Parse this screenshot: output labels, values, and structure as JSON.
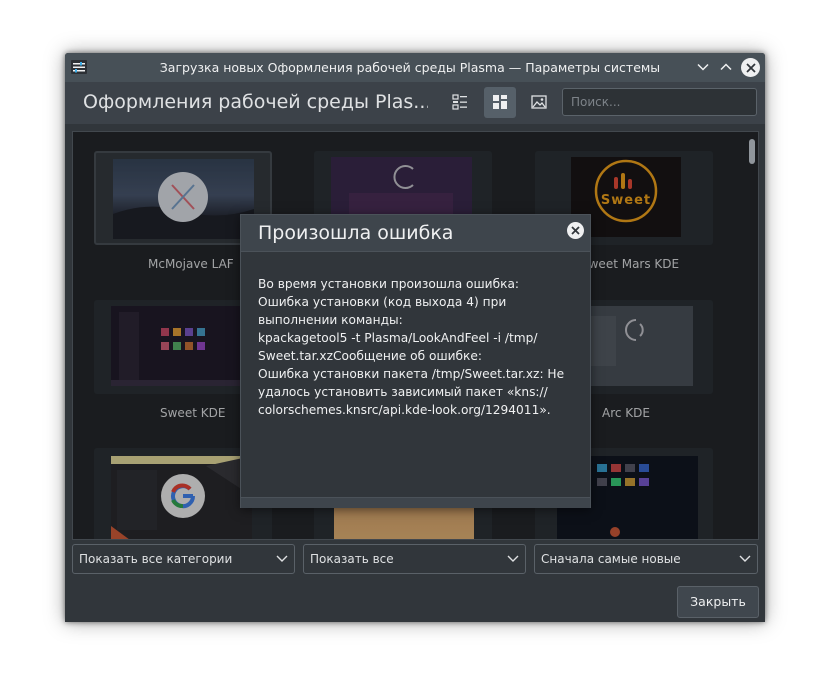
{
  "window": {
    "title": "Загрузка новых Оформления рабочей среды Plasma — Параметры системы"
  },
  "toolbar": {
    "title": "Оформления рабочей среды Plas...",
    "view_icons": [
      "details-view-icon",
      "tiles-view-icon",
      "preview-view-icon"
    ],
    "search_placeholder": "Поиск..."
  },
  "grid": {
    "items": [
      {
        "label": "McMojave LAF"
      },
      {
        "label": ""
      },
      {
        "label": "Sweet Mars KDE",
        "thumb_text": "Sweet"
      },
      {
        "label": "Sweet KDE"
      },
      {
        "label": ""
      },
      {
        "label": "Arc KDE"
      },
      {
        "label": ""
      },
      {
        "label": ""
      },
      {
        "label": ""
      }
    ]
  },
  "filters": {
    "category": "Показать все категории",
    "show": "Показать все",
    "sort": "Сначала самые новые"
  },
  "footer": {
    "close_label": "Закрыть"
  },
  "dialog": {
    "title": "Произошла ошибка",
    "message": "Во время установки произошла ошибка:\nОшибка установки (код выхода 4) при\nвыполнении команды:\nkpackagetool5 -t Plasma/LookAndFeel -i /tmp/\nSweet.tar.xzСообщение об ошибке:\nОшибка установки пакета /tmp/Sweet.tar.xz: Не\nудалось установить зависимый пакет «kns://\ncolorschemes.knsrc/api.kde-look.org/1294011»."
  },
  "colors": {
    "window_bg": "#31363b",
    "titlebar_bg": "#475057",
    "accent_orange": "#f4a51c"
  }
}
